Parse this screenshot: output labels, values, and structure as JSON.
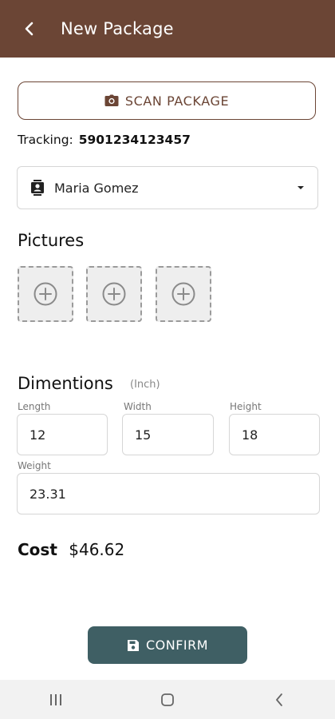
{
  "header": {
    "title": "New Package",
    "background": "#6b4535"
  },
  "scan": {
    "label": "SCAN PACKAGE"
  },
  "tracking": {
    "label": "Tracking:",
    "number": "5901234123457"
  },
  "customer": {
    "selected": "Maria Gomez"
  },
  "pictures": {
    "title": "Pictures",
    "slots": 3
  },
  "dimensions": {
    "title": "Dimentions",
    "units": "(Inch)",
    "length_label": "Length",
    "length": "12",
    "width_label": "Width",
    "width": "15",
    "height_label": "Height",
    "height": "18",
    "weight_label": "Weight",
    "weight": "23.31"
  },
  "cost": {
    "label": "Cost",
    "value": "$46.62"
  },
  "confirm": {
    "label": "CONFIRM",
    "background": "#3f5f64"
  },
  "icons": {
    "back": "chevron-left-icon",
    "scan": "camera-icon",
    "customer": "contact-card-icon",
    "dropdown": "caret-down-icon",
    "add_picture": "plus-circle-icon",
    "confirm": "save-icon",
    "nav_recents": "recents-icon",
    "nav_home": "home-icon",
    "nav_back": "back-icon"
  }
}
